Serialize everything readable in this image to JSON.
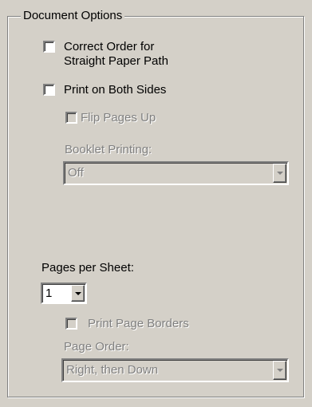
{
  "group": {
    "title": "Document Options"
  },
  "options": {
    "correct_order": {
      "label_line1": "Correct Order for",
      "label_line2": "Straight Paper Path",
      "checked": false
    },
    "both_sides": {
      "label": "Print on Both Sides",
      "checked": false
    },
    "flip_pages": {
      "label": "Flip Pages Up",
      "checked": false,
      "enabled": false
    },
    "booklet": {
      "label": "Booklet Printing:",
      "value": "Off",
      "enabled": false
    },
    "pages_per_sheet": {
      "label": "Pages per Sheet:",
      "value": "1",
      "enabled": true
    },
    "page_borders": {
      "label": "Print Page Borders",
      "checked": false,
      "enabled": false
    },
    "page_order": {
      "label": "Page Order:",
      "value": "Right, then Down",
      "enabled": false
    }
  },
  "icons": {
    "dropdown": "chevron-down-icon"
  },
  "colors": {
    "face": "#d4d0c8",
    "shadow": "#808080",
    "highlight": "#ffffff"
  }
}
